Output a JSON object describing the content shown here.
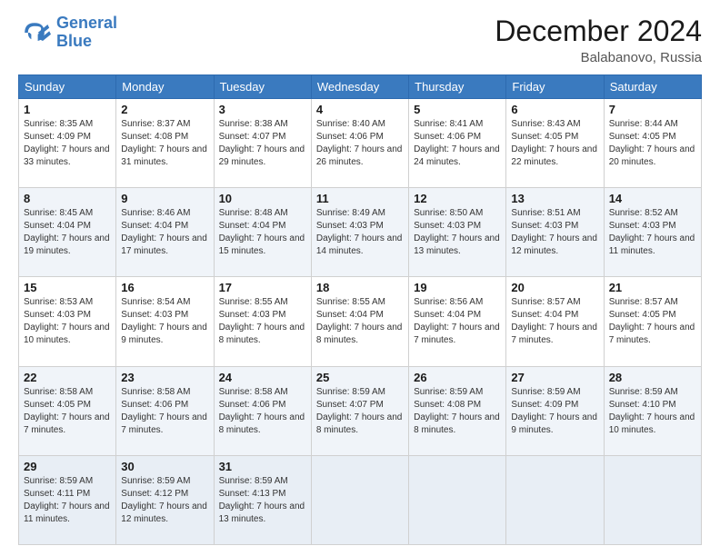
{
  "header": {
    "logo_line1": "General",
    "logo_line2": "Blue",
    "month": "December 2024",
    "location": "Balabanovo, Russia"
  },
  "days_of_week": [
    "Sunday",
    "Monday",
    "Tuesday",
    "Wednesday",
    "Thursday",
    "Friday",
    "Saturday"
  ],
  "weeks": [
    [
      {
        "day": "1",
        "sunrise": "8:35 AM",
        "sunset": "4:09 PM",
        "daylight": "7 hours and 33 minutes."
      },
      {
        "day": "2",
        "sunrise": "8:37 AM",
        "sunset": "4:08 PM",
        "daylight": "7 hours and 31 minutes."
      },
      {
        "day": "3",
        "sunrise": "8:38 AM",
        "sunset": "4:07 PM",
        "daylight": "7 hours and 29 minutes."
      },
      {
        "day": "4",
        "sunrise": "8:40 AM",
        "sunset": "4:06 PM",
        "daylight": "7 hours and 26 minutes."
      },
      {
        "day": "5",
        "sunrise": "8:41 AM",
        "sunset": "4:06 PM",
        "daylight": "7 hours and 24 minutes."
      },
      {
        "day": "6",
        "sunrise": "8:43 AM",
        "sunset": "4:05 PM",
        "daylight": "7 hours and 22 minutes."
      },
      {
        "day": "7",
        "sunrise": "8:44 AM",
        "sunset": "4:05 PM",
        "daylight": "7 hours and 20 minutes."
      }
    ],
    [
      {
        "day": "8",
        "sunrise": "8:45 AM",
        "sunset": "4:04 PM",
        "daylight": "7 hours and 19 minutes."
      },
      {
        "day": "9",
        "sunrise": "8:46 AM",
        "sunset": "4:04 PM",
        "daylight": "7 hours and 17 minutes."
      },
      {
        "day": "10",
        "sunrise": "8:48 AM",
        "sunset": "4:04 PM",
        "daylight": "7 hours and 15 minutes."
      },
      {
        "day": "11",
        "sunrise": "8:49 AM",
        "sunset": "4:03 PM",
        "daylight": "7 hours and 14 minutes."
      },
      {
        "day": "12",
        "sunrise": "8:50 AM",
        "sunset": "4:03 PM",
        "daylight": "7 hours and 13 minutes."
      },
      {
        "day": "13",
        "sunrise": "8:51 AM",
        "sunset": "4:03 PM",
        "daylight": "7 hours and 12 minutes."
      },
      {
        "day": "14",
        "sunrise": "8:52 AM",
        "sunset": "4:03 PM",
        "daylight": "7 hours and 11 minutes."
      }
    ],
    [
      {
        "day": "15",
        "sunrise": "8:53 AM",
        "sunset": "4:03 PM",
        "daylight": "7 hours and 10 minutes."
      },
      {
        "day": "16",
        "sunrise": "8:54 AM",
        "sunset": "4:03 PM",
        "daylight": "7 hours and 9 minutes."
      },
      {
        "day": "17",
        "sunrise": "8:55 AM",
        "sunset": "4:03 PM",
        "daylight": "7 hours and 8 minutes."
      },
      {
        "day": "18",
        "sunrise": "8:55 AM",
        "sunset": "4:04 PM",
        "daylight": "7 hours and 8 minutes."
      },
      {
        "day": "19",
        "sunrise": "8:56 AM",
        "sunset": "4:04 PM",
        "daylight": "7 hours and 7 minutes."
      },
      {
        "day": "20",
        "sunrise": "8:57 AM",
        "sunset": "4:04 PM",
        "daylight": "7 hours and 7 minutes."
      },
      {
        "day": "21",
        "sunrise": "8:57 AM",
        "sunset": "4:05 PM",
        "daylight": "7 hours and 7 minutes."
      }
    ],
    [
      {
        "day": "22",
        "sunrise": "8:58 AM",
        "sunset": "4:05 PM",
        "daylight": "7 hours and 7 minutes."
      },
      {
        "day": "23",
        "sunrise": "8:58 AM",
        "sunset": "4:06 PM",
        "daylight": "7 hours and 7 minutes."
      },
      {
        "day": "24",
        "sunrise": "8:58 AM",
        "sunset": "4:06 PM",
        "daylight": "7 hours and 8 minutes."
      },
      {
        "day": "25",
        "sunrise": "8:59 AM",
        "sunset": "4:07 PM",
        "daylight": "7 hours and 8 minutes."
      },
      {
        "day": "26",
        "sunrise": "8:59 AM",
        "sunset": "4:08 PM",
        "daylight": "7 hours and 8 minutes."
      },
      {
        "day": "27",
        "sunrise": "8:59 AM",
        "sunset": "4:09 PM",
        "daylight": "7 hours and 9 minutes."
      },
      {
        "day": "28",
        "sunrise": "8:59 AM",
        "sunset": "4:10 PM",
        "daylight": "7 hours and 10 minutes."
      }
    ],
    [
      {
        "day": "29",
        "sunrise": "8:59 AM",
        "sunset": "4:11 PM",
        "daylight": "7 hours and 11 minutes."
      },
      {
        "day": "30",
        "sunrise": "8:59 AM",
        "sunset": "4:12 PM",
        "daylight": "7 hours and 12 minutes."
      },
      {
        "day": "31",
        "sunrise": "8:59 AM",
        "sunset": "4:13 PM",
        "daylight": "7 hours and 13 minutes."
      },
      null,
      null,
      null,
      null
    ]
  ]
}
